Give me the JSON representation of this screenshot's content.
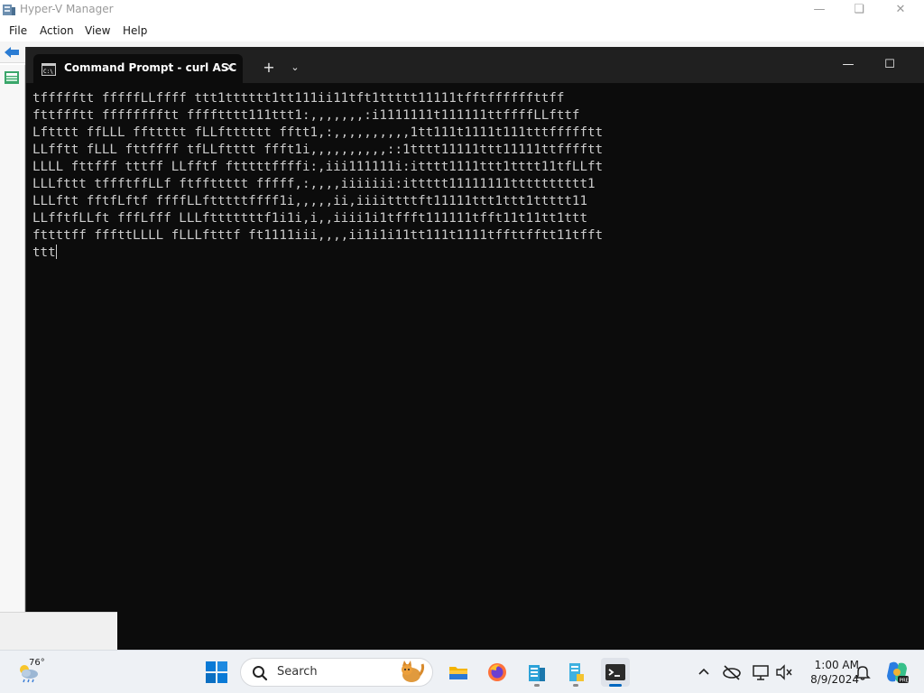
{
  "hyperv": {
    "title": "Hyper-V Manager",
    "menu": [
      "File",
      "Action",
      "View",
      "Help"
    ]
  },
  "terminal": {
    "tab_title": "Command Prompt - curl  ASC",
    "lines": [
      "tffffftt fffffLLffff ttt1tttttt1tt111ii11tft1ttttt11111tfftffffffttff",
      "fttffftt fffffffftt fffftttt111ttt1:,,,,,,,:i1111111t111111ttffffLLfttf",
      "Lftttt ffLLL ffttttt fLLftttttt fftt1,:,,,,,,,,,,1tt111t1111t111tttffffftt",
      "LLfftt fLLL fttffff tfLLftttt ffft1i,,,,,,,,,,::1tttt11111ttt11111ttfffftt",
      "LLLL fttfff tttff LLfftf ftttttffffi:,iii111111i:itttt1111ttt1tttt11tfLLft",
      "LLLfttt tffftffLLf ftffttttt fffff,:,,,,iiiiiii:ittttt11111111tttttttttt1",
      "LLLftt fftfLftf ffffLLftttttffff1i,,,,,ii,iiiittttft11111ttt1ttt1ttttt11",
      "LLfftfLLft fffLfff LLLftttttttf1i1i,i,,iiii1i1tffft111111tfft11t11tt1ttt",
      "fttttff fffttLLLL fLLLftttf ft1111iii,,,,ii1i1i11tt111t1111tffttfftt11tfft",
      "ttt"
    ]
  },
  "taskbar": {
    "weather_temp": "76°",
    "search_label": "Search",
    "clock_time": "1:00 AM",
    "clock_date": "8/9/2024"
  }
}
